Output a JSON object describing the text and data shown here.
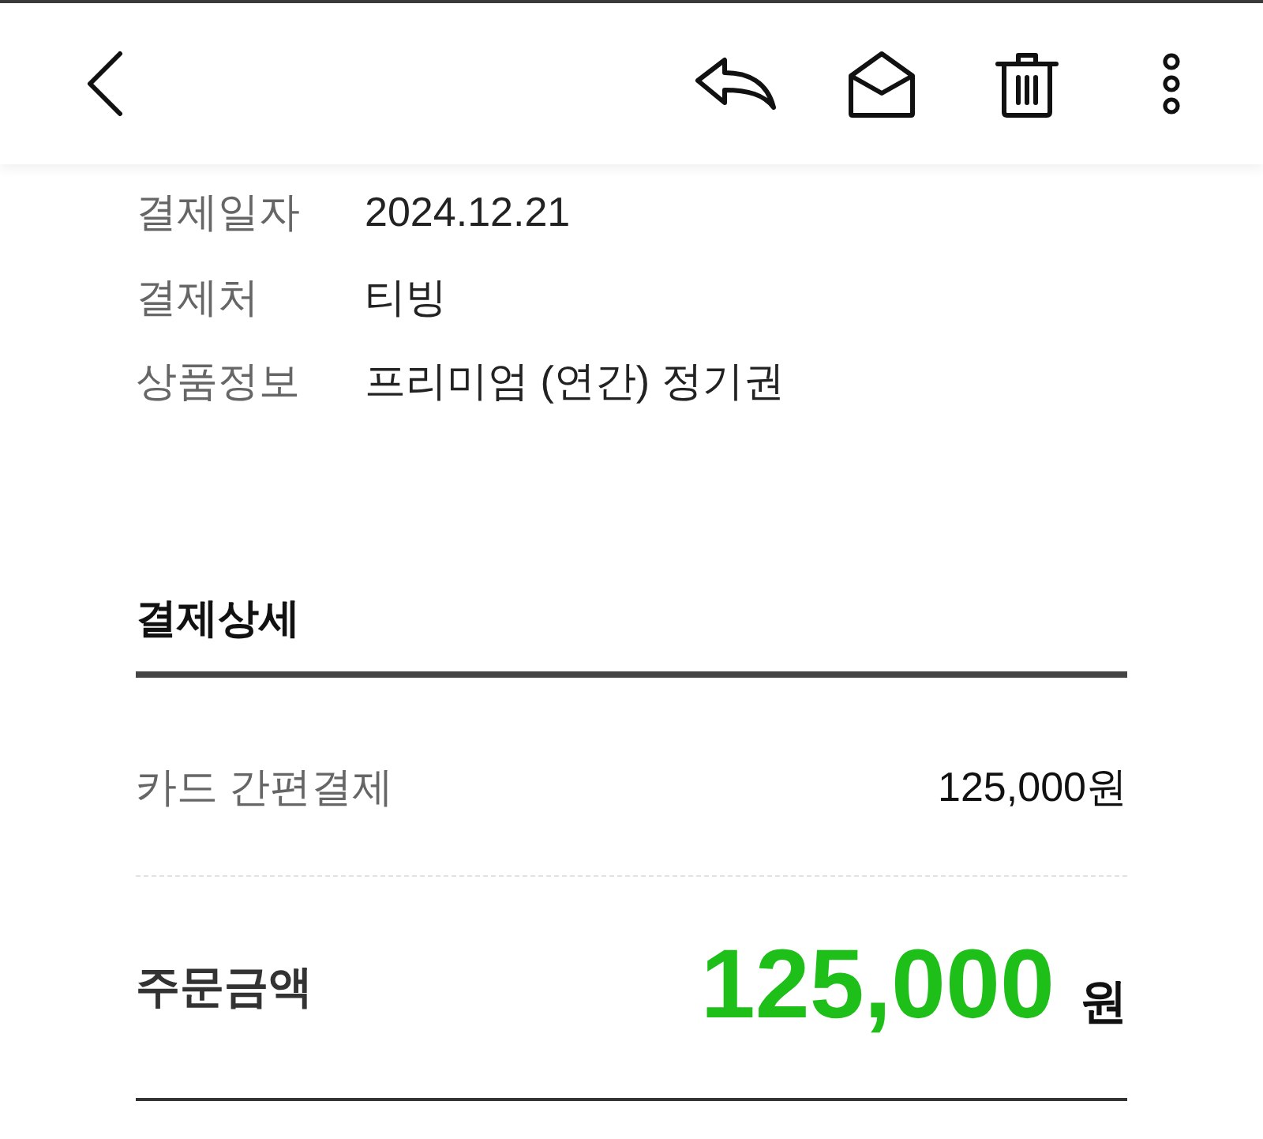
{
  "info_rows": [
    {
      "label": "결제일자",
      "value": "2024.12.21"
    },
    {
      "label": "결제처",
      "value": "티빙"
    },
    {
      "label": "상품정보",
      "value": "프리미엄 (연간) 정기권"
    }
  ],
  "payment_details": {
    "title": "결제상세",
    "items": [
      {
        "label": "카드 간편결제",
        "amount": "125,000원"
      }
    ],
    "total": {
      "label": "주문금액",
      "amount": "125,000",
      "unit": "원"
    }
  }
}
